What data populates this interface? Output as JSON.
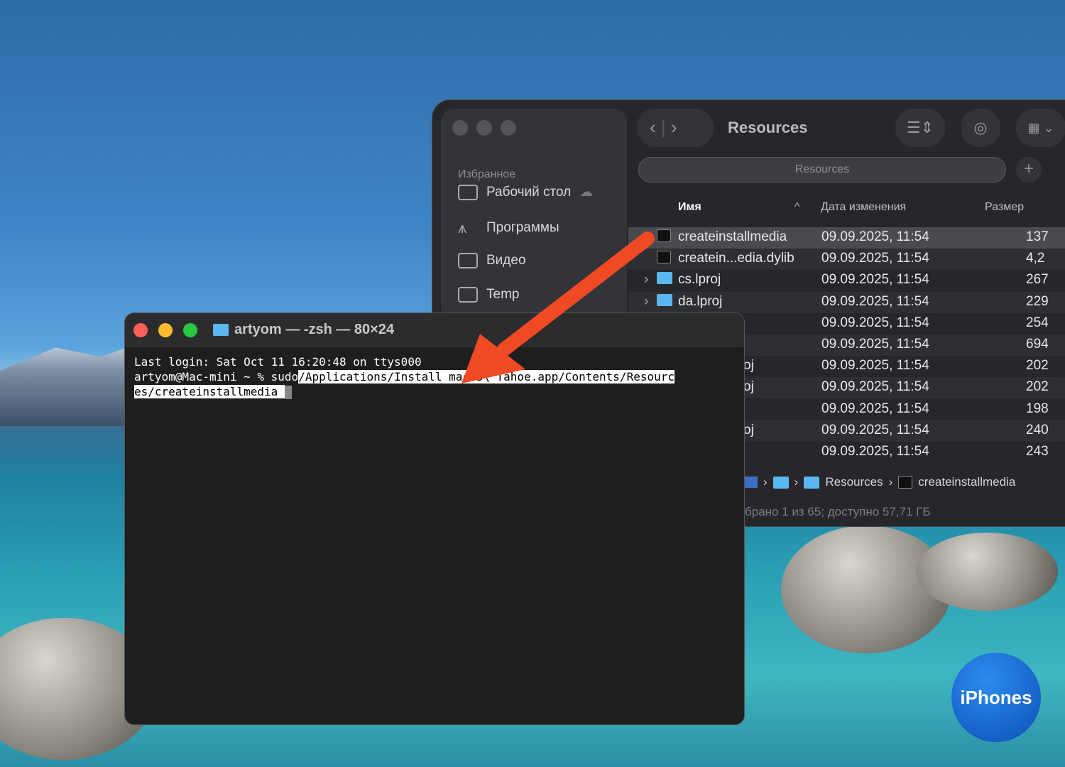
{
  "finder": {
    "title": "Resources",
    "search": "Resources",
    "sidebar_heading": "Избранное",
    "sidebar": [
      {
        "label": "Рабочий стол"
      },
      {
        "label": "Программы"
      },
      {
        "label": "Видео"
      },
      {
        "label": "Temp"
      }
    ],
    "columns": {
      "name": "Имя",
      "date": "Дата изменения",
      "size": "Размер"
    },
    "rows": [
      {
        "name": "createinstallmedia",
        "date": "09.09.2025, 11:54",
        "size": "137",
        "type": "exec"
      },
      {
        "name": "createin...edia.dylib",
        "date": "09.09.2025, 11:54",
        "size": "4,2",
        "type": "exec"
      },
      {
        "name": "cs.lproj",
        "date": "09.09.2025, 11:54",
        "size": "267",
        "type": "folder"
      },
      {
        "name": "da.lproj",
        "date": "09.09.2025, 11:54",
        "size": "229",
        "type": "folder"
      },
      {
        "name": "",
        "date": "09.09.2025, 11:54",
        "size": "254"
      },
      {
        "name": "",
        "date": "09.09.2025, 11:54",
        "size": "694"
      },
      {
        "name": "oj",
        "date": "09.09.2025, 11:54",
        "size": "202"
      },
      {
        "name": "oj",
        "date": "09.09.2025, 11:54",
        "size": "202"
      },
      {
        "name": "",
        "date": "09.09.2025, 11:54",
        "size": "198"
      },
      {
        "name": "oj",
        "date": "09.09.2025, 11:54",
        "size": "240"
      },
      {
        "name": "",
        "date": "09.09.2025, 11:54",
        "size": "243"
      }
    ],
    "path": [
      "Resources",
      "createinstallmedia"
    ],
    "status": "брано 1 из 65; доступно 57,71 ГБ"
  },
  "terminal": {
    "title": "artyom — -zsh — 80×24",
    "line1": "Last login: Sat Oct 11 16:20:48 on ttys000",
    "prompt": "artyom@Mac-mini ~ % sudo",
    "cmd1": "/Applications/Install macOS\\ Tahoe.app/Contents/Resourc",
    "cmd2": "es/createinstallmedia "
  },
  "watermark": "iPhones",
  "colors": {
    "arrow": "#f04a24",
    "accent": "#5bb7ef"
  }
}
